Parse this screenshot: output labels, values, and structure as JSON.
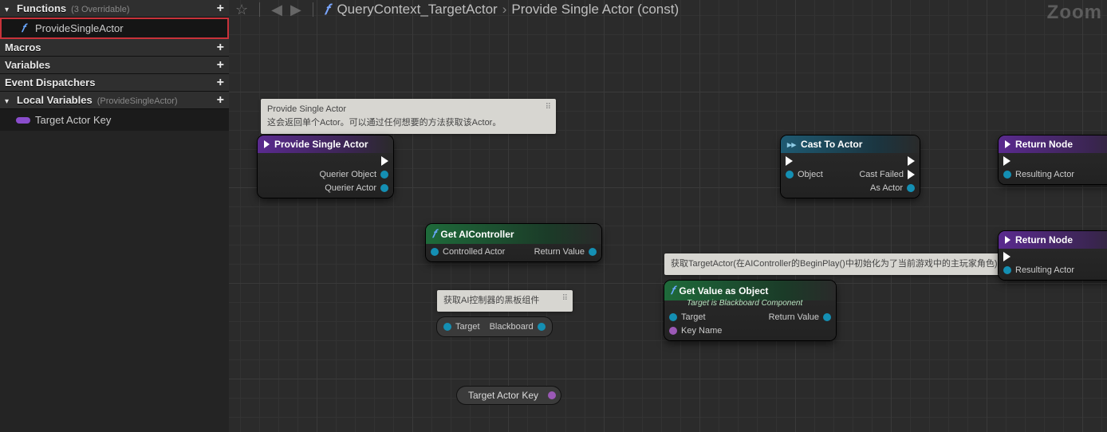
{
  "sidebar": {
    "functions": {
      "title": "Functions",
      "hint": "(3 Overridable)",
      "items": [
        {
          "name": "ProvideSingleActor"
        }
      ]
    },
    "macros": {
      "title": "Macros"
    },
    "variables": {
      "title": "Variables"
    },
    "dispatchers": {
      "title": "Event Dispatchers"
    },
    "local_vars": {
      "title": "Local Variables",
      "hint": "(ProvideSingleActor)",
      "items": [
        {
          "name": "Target Actor Key"
        }
      ]
    }
  },
  "toolbar": {
    "breadcrumb1": "QueryContext_TargetActor",
    "breadcrumb2": "Provide Single Actor (const)",
    "zoom": "Zoom"
  },
  "tips": {
    "psa_title": "Provide Single Actor",
    "psa_body": "这会返回单个Actor。可以通过任何想要的方法获取该Actor。",
    "bb": "获取AI控制器的黑板组件",
    "target_actor": "获取TargetActor(在AIController的BeginPlay()中初始化为了当前游戏中的主玩家角色)"
  },
  "nodes": {
    "psa": {
      "title": "Provide Single Actor",
      "pin_querier_object": "Querier Object",
      "pin_querier_actor": "Querier Actor"
    },
    "get_ai": {
      "title": "Get AIController",
      "pin_in": "Controlled Actor",
      "pin_out": "Return Value"
    },
    "blackboard": {
      "pin_in": "Target",
      "pin_out": "Blackboard"
    },
    "gvao": {
      "title": "Get Value as Object",
      "sub": "Target is Blackboard Component",
      "pin_target": "Target",
      "pin_key": "Key Name",
      "pin_out": "Return Value"
    },
    "cast": {
      "title": "Cast To Actor",
      "pin_object": "Object",
      "pin_fail": "Cast Failed",
      "pin_as": "As Actor"
    },
    "ret1": {
      "title": "Return Node",
      "pin_out": "Resulting Actor"
    },
    "ret2": {
      "title": "Return Node",
      "pin_out": "Resulting Actor"
    },
    "varkey": "Target Actor Key"
  }
}
